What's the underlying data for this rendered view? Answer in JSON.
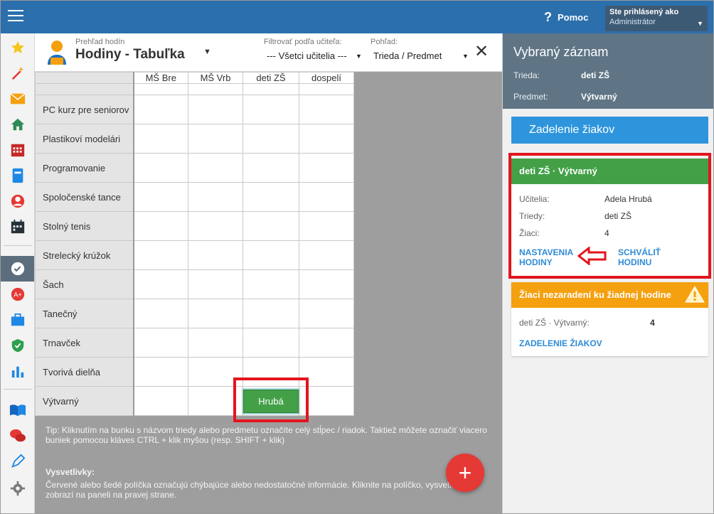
{
  "topbar": {
    "help_label": "Pomoc",
    "user_line1": "Ste prihlásený ako",
    "user_line2": "Administrátor"
  },
  "sidebar": {
    "icons": [
      "star-icon",
      "magic-wand-icon",
      "envelope-icon",
      "home-icon",
      "calendar-grid-icon",
      "phone-book-icon",
      "user-circle-icon",
      "calendar-icon",
      "check-circle-icon",
      "grade-icon",
      "briefcase-icon",
      "shield-check-icon",
      "bar-chart-icon",
      "book-icon",
      "chat-icon",
      "pen-icon",
      "gear-icon"
    ]
  },
  "header": {
    "subtitle": "Prehľad hodín",
    "title": "Hodiny - Tabuľka",
    "filter_label": "Filtrovať podľa učiteľa:",
    "filter_value": "--- Všetci učitelia ---",
    "view_label": "Pohľad:",
    "view_value": "Trieda / Predmet"
  },
  "grid": {
    "columns": [
      "MŠ Bre",
      "MŠ Vrb",
      "deti ZŠ",
      "dospelí"
    ],
    "rows": [
      "PC kurz pre seniorov",
      "Plastikoví modelári",
      "Programovanie",
      "Spoločenské tance",
      "Stolný tenis",
      "Strelecký krúžok",
      "Šach",
      "Tanečný",
      "Trnavček",
      "Tvorivá dielňa",
      "Výtvarný"
    ],
    "selected_cell_label": "Hrubá"
  },
  "tip": "Tip: Kliknutím na bunku s názvom triedy alebo predmetu označíte celý stĺpec / riadok. Taktiež môžete označiť viacero buniek pomocou kláves CTRL + klik myšou (resp. SHIFT + klik)",
  "legend": {
    "title": "Vysvetlivky:",
    "text": "Červené alebo šedé políčka označujú chýbajúce alebo nedostatočné informácie. Kliknite na políčko, vysvetl... zobrazí na paneli na pravej strane."
  },
  "fab_label": "+",
  "right_panel": {
    "title": "Vybraný záznam",
    "class_label": "Trieda:",
    "class_value": "deti ZŠ",
    "subject_label": "Predmet:",
    "subject_value": "Výtvarný",
    "assign_button": "Zadelenie žiakov",
    "card": {
      "title": "deti ZŠ · Výtvarný",
      "teachers_label": "Učitelia:",
      "teachers_value": "Adela Hrubá",
      "classes_label": "Triedy:",
      "classes_value": "deti ZŠ",
      "students_label": "Žiaci:",
      "students_value": "4",
      "settings_link_1": "NASTAVENIA",
      "settings_link_2": "HODINY",
      "approve_link_1": "SCHVÁLIŤ",
      "approve_link_2": "HODINU"
    },
    "warn_card": {
      "title": "Žiaci nezaradení ku žiadnej hodine",
      "item_label": "deti ZŠ · Výtvarný:",
      "item_value": "4",
      "link": "ZADELENIE ŽIAKOV"
    }
  },
  "colors": {
    "topbar": "#2b6fad",
    "green": "#43a047",
    "orange": "#f5a00f",
    "highlight_red": "#e3151e",
    "link_blue": "#2e8bd6"
  }
}
